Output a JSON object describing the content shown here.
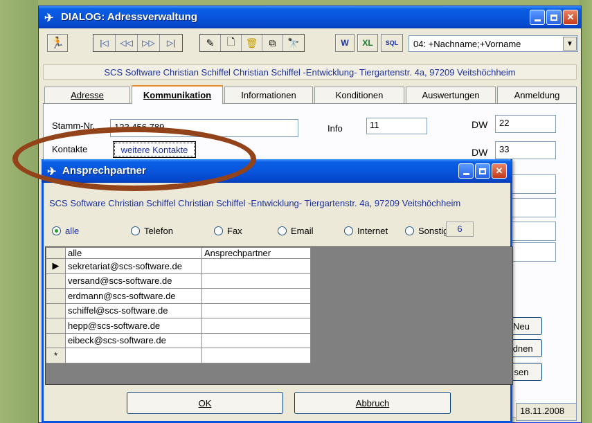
{
  "main_window": {
    "title": "DIALOG: Adressverwaltung",
    "sort_select": {
      "value": "04: +Nachname;+Vorname"
    },
    "toolbar": {
      "nav_buttons": [
        "|◁",
        "◁◁",
        "▷▷",
        "▷|"
      ],
      "edit_buttons": [
        "✎",
        "🗋",
        "🗑",
        "⧉",
        "🔭"
      ],
      "extra_buttons": [
        "W",
        "XL",
        "SQL"
      ]
    },
    "company_line": "SCS Software Christian Schiffel Christian Schiffel -Entwicklung- Tiergartenstr. 4a, 97209 Veitshöchheim",
    "tabs": [
      "Adresse",
      "Kommunikation",
      "Informationen",
      "Konditionen",
      "Auswertungen",
      "Anmeldung"
    ],
    "active_tab": "Kommunikation",
    "fields": {
      "stamm_label": "Stamm-Nr.",
      "stamm_value": "123 456 789",
      "info_label": "Info",
      "info_value": "11",
      "dw_label": "DW",
      "dw1_value": "22",
      "dw2_value": "33",
      "kontakte_label": "Kontakte",
      "kontakte_button": "weitere Kontakte"
    },
    "side_buttons": [
      "Neu",
      "rdnen",
      "sen"
    ],
    "date": "18.11.2008"
  },
  "dialog": {
    "title": "Ansprechpartner",
    "company_line": "SCS Software Christian Schiffel Christian Schiffel -Entwicklung- Tiergartenstr. 4a, 97209 Veitshöchheim",
    "radios": [
      "alle",
      "Telefon",
      "Fax",
      "Email",
      "Internet",
      "Sonstige"
    ],
    "selected_radio": "alle",
    "count": "6",
    "grid": {
      "headers": [
        "alle",
        "Ansprechpartner"
      ],
      "rows": [
        {
          "alle": "sekretariat@scs-software.de",
          "partner": ""
        },
        {
          "alle": "versand@scs-software.de",
          "partner": ""
        },
        {
          "alle": "erdmann@scs-software.de",
          "partner": ""
        },
        {
          "alle": "schiffel@scs-software.de",
          "partner": ""
        },
        {
          "alle": "hepp@scs-software.de",
          "partner": ""
        },
        {
          "alle": "eibeck@scs-software.de",
          "partner": ""
        }
      ],
      "new_row_marker": "*",
      "current_row_marker": "▶"
    },
    "ok_label": "OK",
    "cancel_label": "Abbruch"
  },
  "colors": {
    "highlight_ellipse": "#924319",
    "title_blue": "#0855dd",
    "link_blue": "#1c2fa0"
  }
}
